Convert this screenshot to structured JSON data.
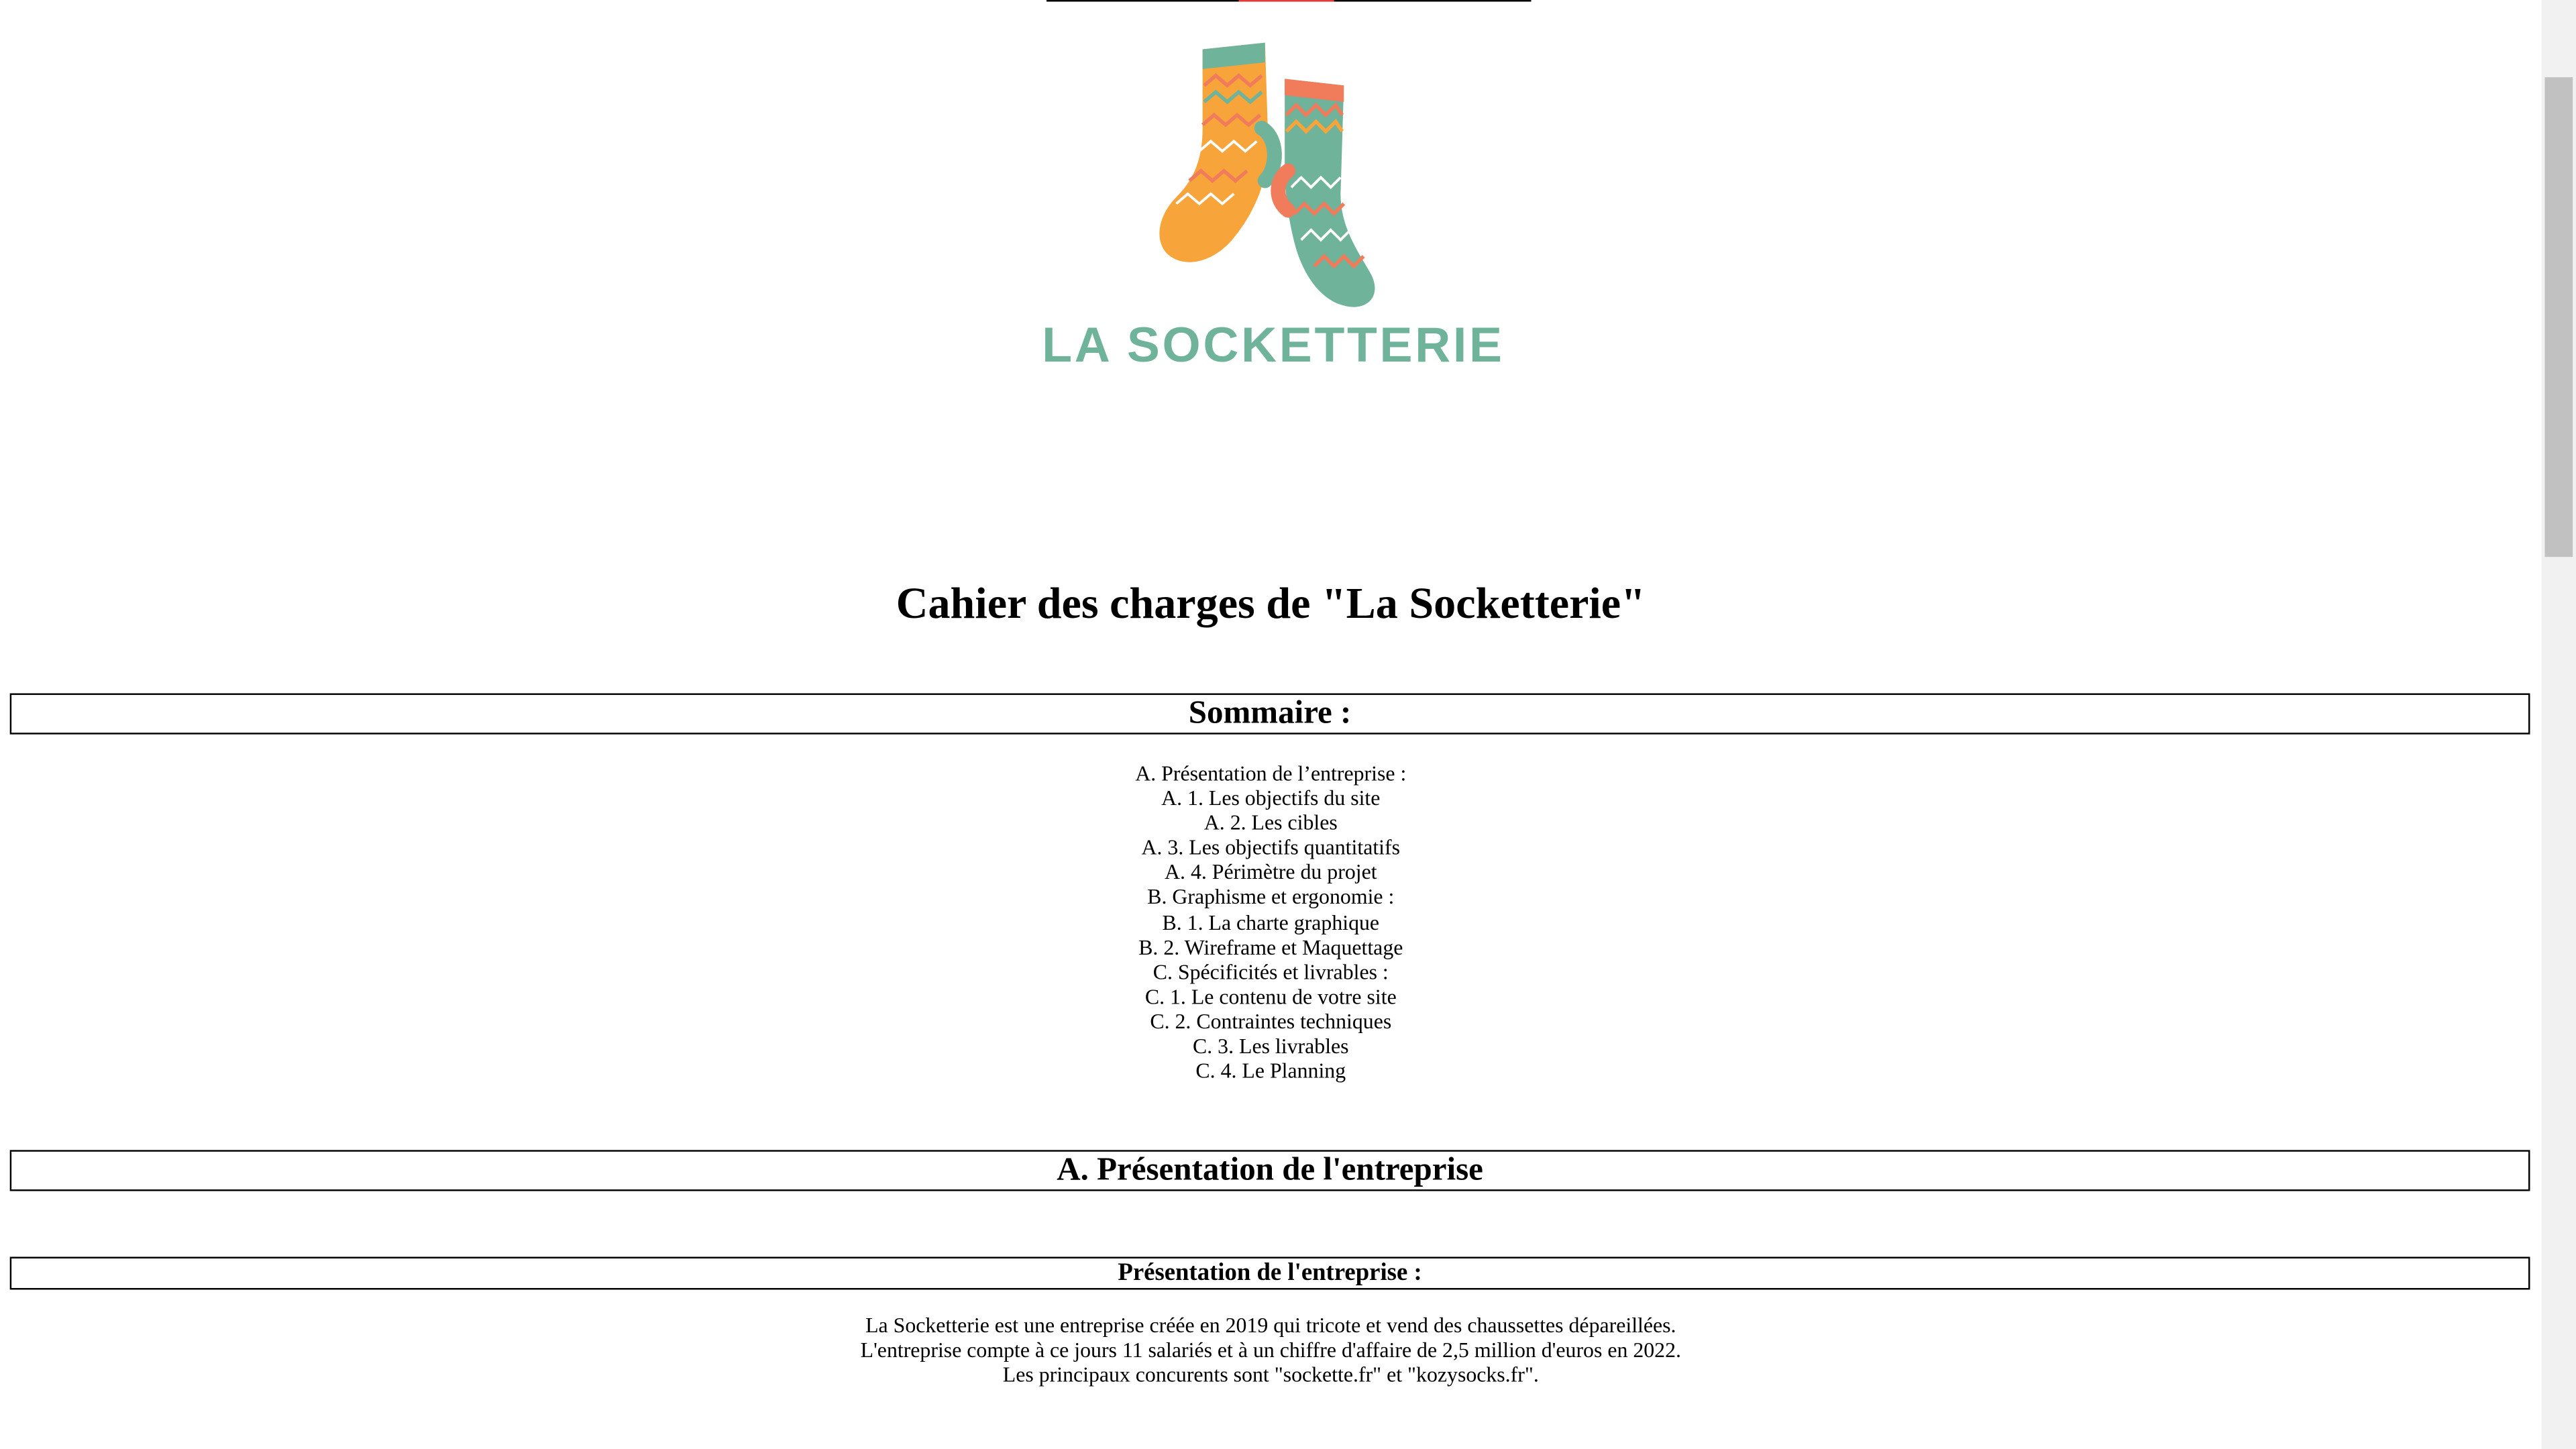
{
  "header": {
    "logo_text": "LA SOCKETTERIE",
    "logo_icon": "socks-logo-icon",
    "colors": {
      "orange": "#f7a43a",
      "teal": "#6fb39a",
      "coral": "#f07c5c",
      "logo_text": "#6fb39a"
    }
  },
  "title": "Cahier des charges de \"La Socketterie\"",
  "sommaire": {
    "heading": "Sommaire :",
    "items": [
      "A. Présentation de l’entreprise :",
      "A. 1. Les objectifs du site",
      "A. 2. Les cibles",
      "A. 3. Les objectifs quantitatifs",
      "A. 4. Périmètre du projet",
      "B. Graphisme et ergonomie :",
      "B. 1. La charte graphique",
      "B. 2. Wireframe et Maquettage",
      "C. Spécificités et livrables :",
      "C. 1. Le contenu de votre site",
      "C. 2. Contraintes techniques",
      "C. 3. Les livrables",
      "C. 4. Le Planning"
    ]
  },
  "section_a": {
    "heading": "A. Présentation de l'entreprise",
    "sub_heading": "Présentation de l'entreprise :",
    "lines": [
      "La Socketterie est une entreprise créée en 2019 qui tricote et vend des chaussettes dépareillées.",
      "L'entreprise compte à ce jours 11 salariés et à un chiffre d'affaire de 2,5 million d'euros en 2022.",
      "Les principaux concurents sont \"sockette.fr\" et \"kozysocks.fr\"."
    ]
  },
  "scrollbar": {
    "position_fraction": 0.0
  }
}
